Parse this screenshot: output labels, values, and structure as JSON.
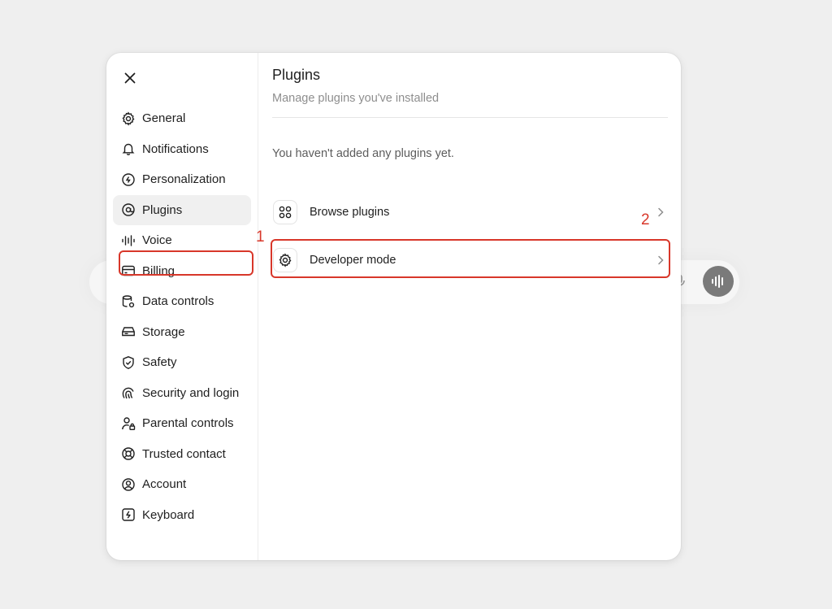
{
  "dialog": {
    "close_icon": "close-icon"
  },
  "sidebar": {
    "items": [
      {
        "label": "General",
        "icon": "gear-icon"
      },
      {
        "label": "Notifications",
        "icon": "bell-icon"
      },
      {
        "label": "Personalization",
        "icon": "personalization-icon"
      },
      {
        "label": "Plugins",
        "icon": "at-sign-icon",
        "active": true
      },
      {
        "label": "Voice",
        "icon": "waveform-icon"
      },
      {
        "label": "Billing",
        "icon": "credit-card-icon"
      },
      {
        "label": "Data controls",
        "icon": "database-gear-icon"
      },
      {
        "label": "Storage",
        "icon": "storage-icon"
      },
      {
        "label": "Safety",
        "icon": "shield-check-icon"
      },
      {
        "label": "Security and login",
        "icon": "fingerprint-icon"
      },
      {
        "label": "Parental controls",
        "icon": "user-lock-icon"
      },
      {
        "label": "Trusted contact",
        "icon": "lifebuoy-icon"
      },
      {
        "label": "Account",
        "icon": "user-circle-icon"
      },
      {
        "label": "Keyboard",
        "icon": "keyboard-bolt-icon"
      }
    ]
  },
  "main": {
    "title": "Plugins",
    "subtitle": "Manage plugins you've installed",
    "empty_message": "You haven't added any plugins yet.",
    "rows": [
      {
        "label": "Browse plugins",
        "icon": "grid-icon"
      },
      {
        "label": "Developer mode",
        "icon": "gear-icon"
      }
    ]
  },
  "annotations": {
    "marker_1": "1",
    "marker_2": "2",
    "color": "#d8372a"
  },
  "colors": {
    "background": "#efefef",
    "dialog": "#ffffff",
    "active_item": "#f0f0f0",
    "muted_text": "#8e8e8e"
  }
}
